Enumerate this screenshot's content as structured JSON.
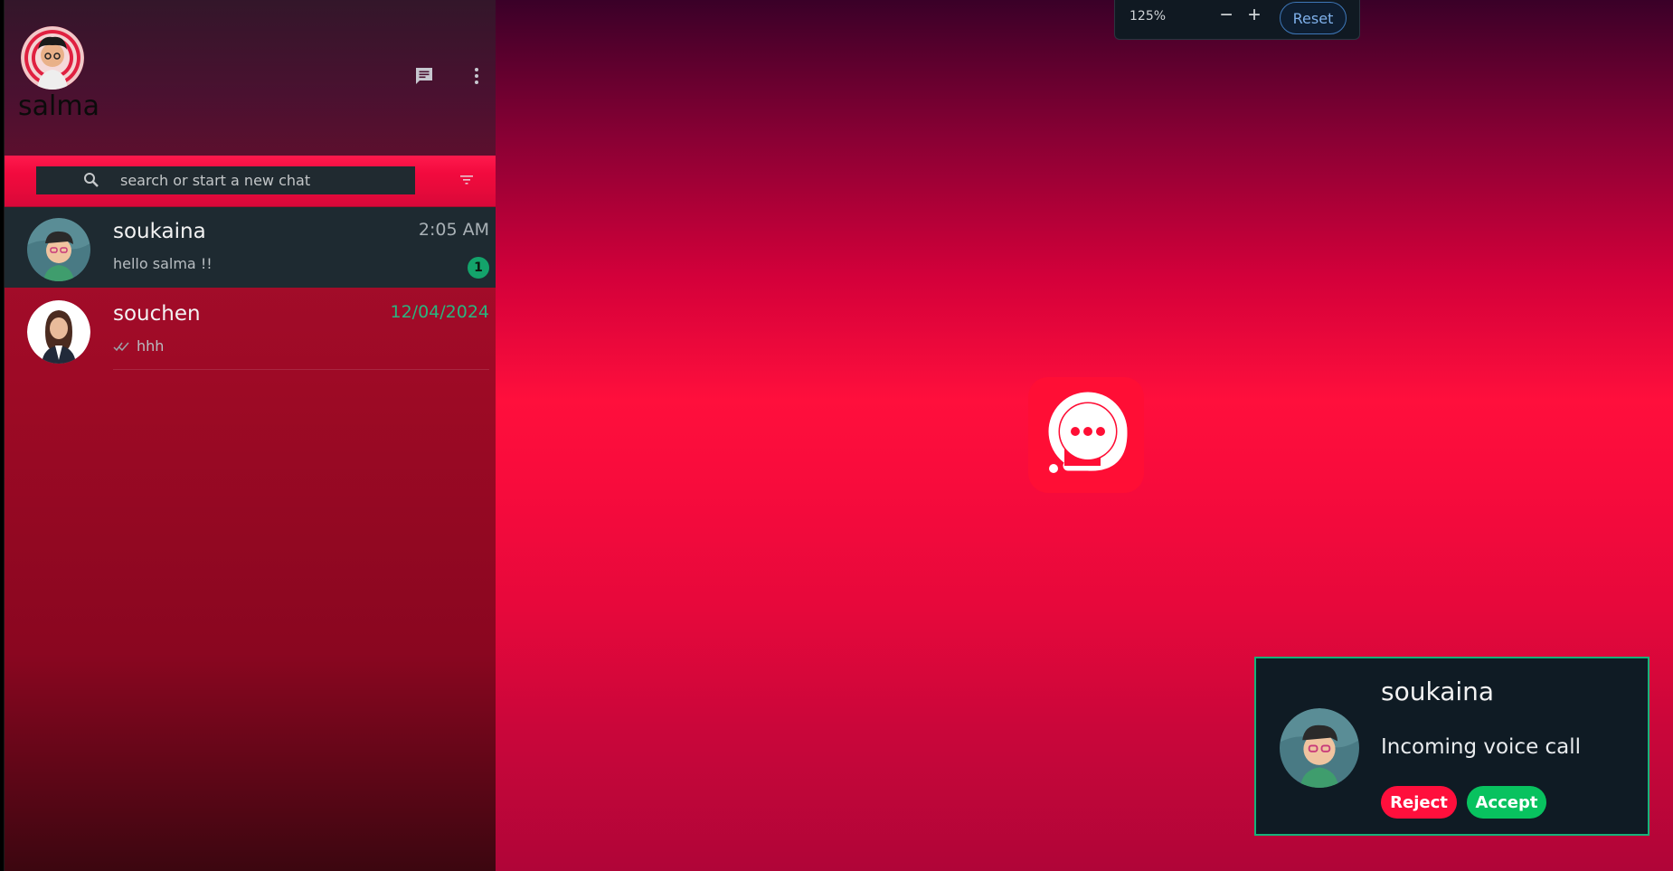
{
  "sidebar": {
    "username": "salma",
    "search": {
      "placeholder": "search or start a new chat"
    },
    "chats": [
      {
        "name": "soukaina",
        "time": "2:05 AM",
        "preview": "hello salma !!",
        "unread": "1"
      },
      {
        "name": "souchen",
        "time": "12/04/2024",
        "preview": "hhh"
      }
    ]
  },
  "zoom_bar": {
    "level": "125%",
    "minus_label": "−",
    "plus_label": "+",
    "reset_label": "Reset"
  },
  "call": {
    "caller": "soukaina",
    "status": "Incoming voice call",
    "reject_label": "Reject",
    "accept_label": "Accept"
  },
  "icons": {
    "new_chat": "chat-bubble-icon",
    "menu": "more-vertical-icon",
    "search": "search-icon",
    "filter": "filter-icon",
    "logo": "app-logo-chat-icon",
    "read_receipt": "double-check-icon"
  },
  "colors": {
    "accent_red": "#ff0f3c",
    "accept_green": "#08c25f",
    "unread_badge": "#13a36b",
    "popup_border": "#16b27a",
    "active_chat_bg": "#1e2a31"
  }
}
